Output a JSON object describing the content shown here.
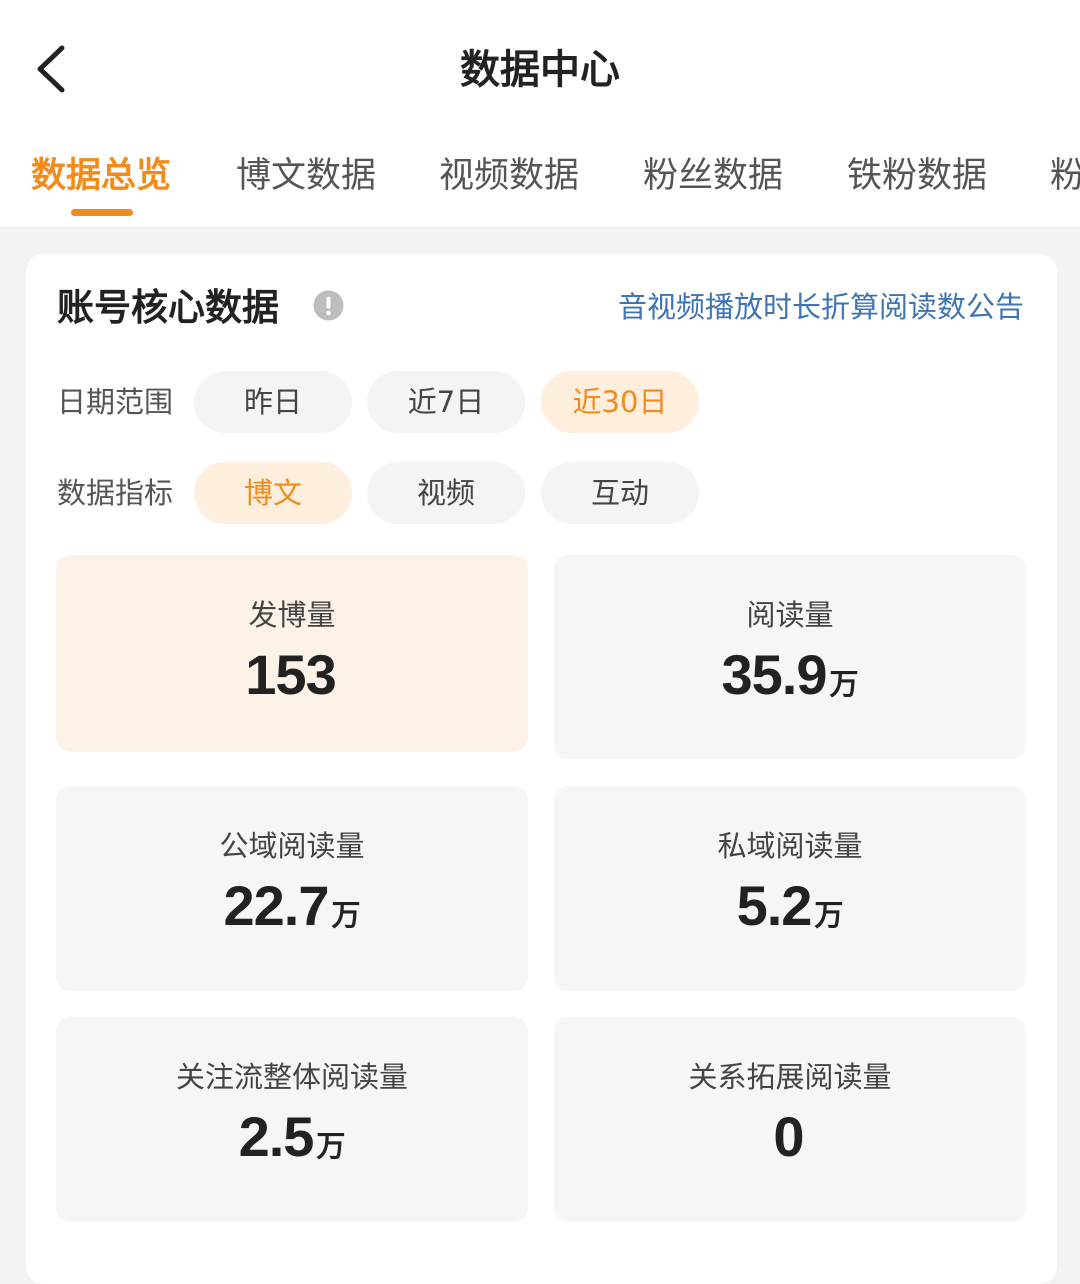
{
  "header": {
    "title": "数据中心",
    "back_icon": "chevron-left-icon"
  },
  "tabs": [
    {
      "label": "数据总览",
      "active": true
    },
    {
      "label": "博文数据",
      "active": false
    },
    {
      "label": "视频数据",
      "active": false
    },
    {
      "label": "粉丝数据",
      "active": false
    },
    {
      "label": "铁粉数据",
      "active": false
    },
    {
      "label": "粉",
      "active": false
    }
  ],
  "core": {
    "title": "账号核心数据",
    "info_icon": "info-icon",
    "notice_link": "音视频播放时长折算阅读数公告",
    "date_range": {
      "label": "日期范围",
      "options": [
        "昨日",
        "近7日",
        "近30日"
      ],
      "selected": "近30日"
    },
    "metric": {
      "label": "数据指标",
      "options": [
        "博文",
        "视频",
        "互动"
      ],
      "selected": "博文"
    },
    "stats": [
      {
        "label": "发博量",
        "value": "153",
        "unit": "",
        "active": true
      },
      {
        "label": "阅读量",
        "value": "35.9",
        "unit": "万",
        "active": false
      },
      {
        "label": "公域阅读量",
        "value": "22.7",
        "unit": "万",
        "active": false
      },
      {
        "label": "私域阅读量",
        "value": "5.2",
        "unit": "万",
        "active": false
      },
      {
        "label": "关注流整体阅读量",
        "value": "2.5",
        "unit": "万",
        "active": false
      },
      {
        "label": "关系拓展阅读量",
        "value": "0",
        "unit": "",
        "active": false
      }
    ]
  },
  "colors": {
    "accent": "#f08b1c",
    "link": "#3f74b3",
    "active_chip_bg": "#fdeedd",
    "active_card_bg": "#fdf2e7"
  }
}
